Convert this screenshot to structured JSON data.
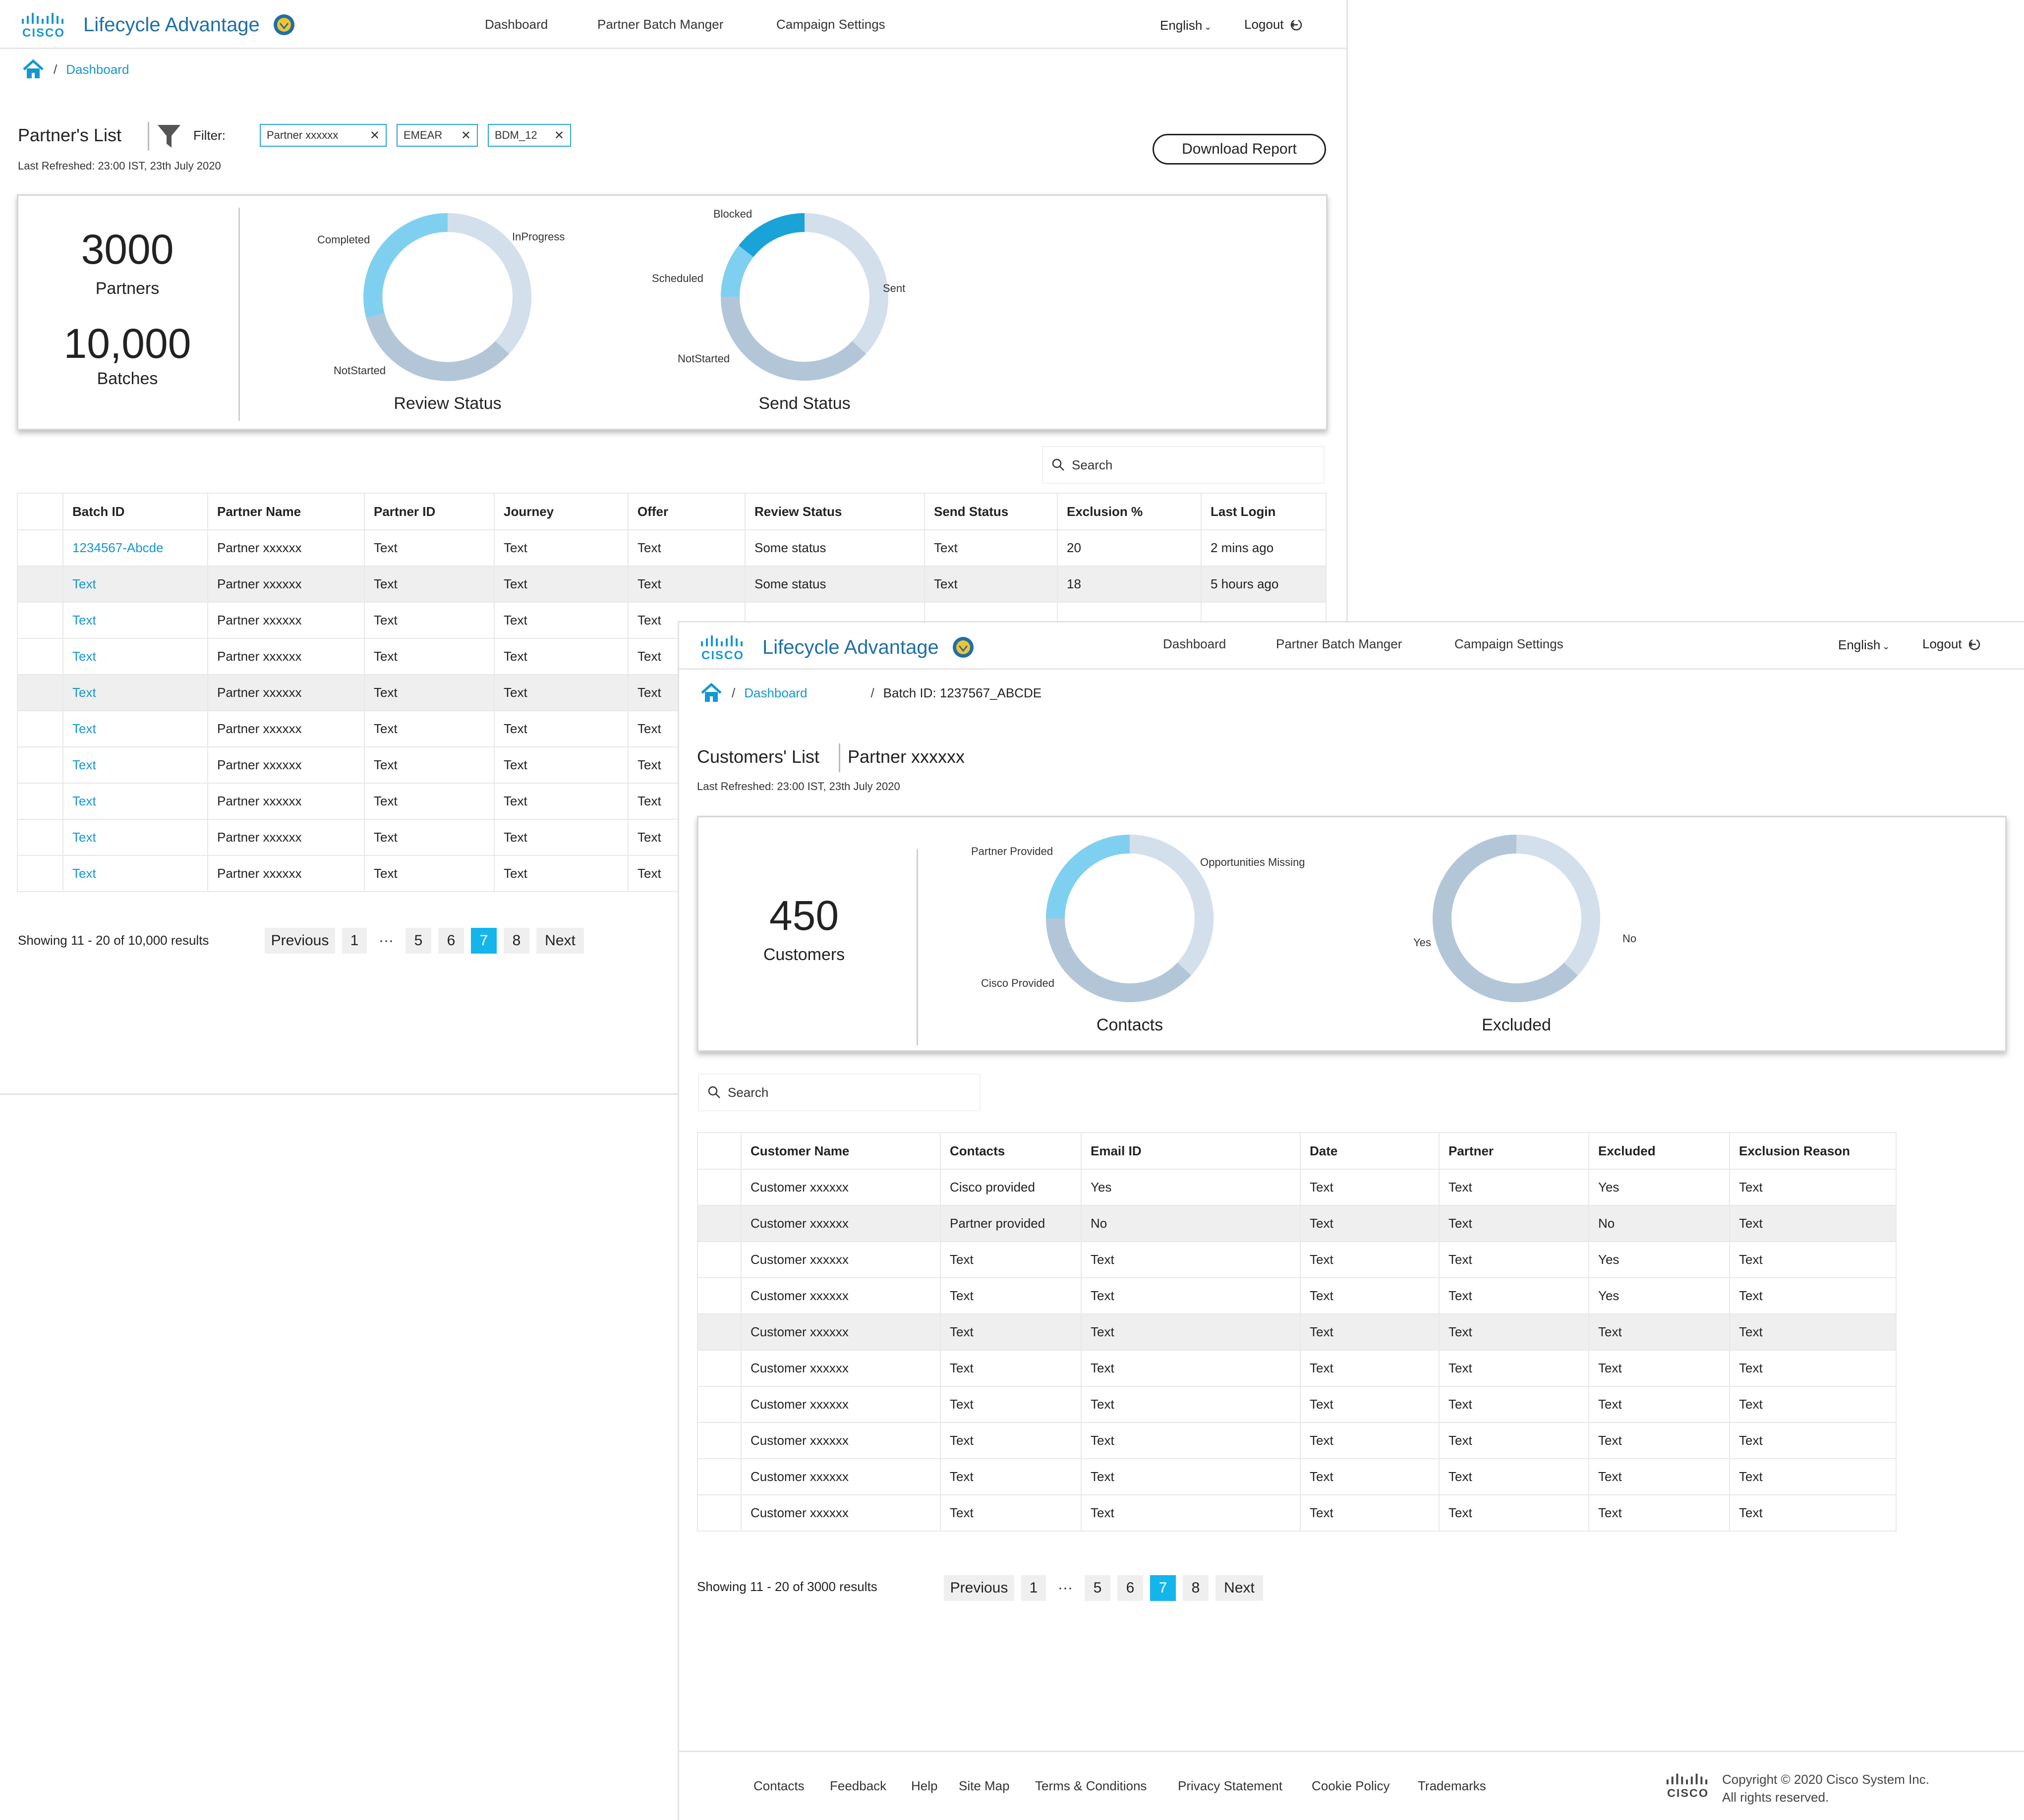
{
  "colors": {
    "accent": "#1597d2",
    "active_page": "#13b5ea",
    "donut_dark": "#1aa3d6",
    "donut_light": "#7fd0f0",
    "donut_pale": "#d3dfeb",
    "donut_mid": "#b2c6d8"
  },
  "win1": {
    "brand": {
      "logo_icon": "cisco-logo-icon",
      "title": "Lifecycle Advantage"
    },
    "nav": {
      "dashboard": "Dashboard",
      "batch": "Partner Batch Manger",
      "campaign": "Campaign Settings"
    },
    "lang": "English",
    "logout": "Logout",
    "crumb": {
      "sep": "/",
      "dashboard": "Dashboard"
    },
    "title": "Partner's List",
    "filter_label": "Filter:",
    "chips": [
      "Partner xxxxxx",
      "EMEAR",
      "BDM_12"
    ],
    "chip_close": "✕",
    "refreshed": "Last Refreshed: 23:00 IST, 23th July 2020",
    "download": "Download Report",
    "stats": {
      "partners_value": "3000",
      "partners_label": "Partners",
      "batches_value": "10,000",
      "batches_label": "Batches"
    },
    "review_labels": {
      "completed": "Completed",
      "inprogress": "InProgress",
      "notstarted": "NotStarted",
      "title": "Review Status"
    },
    "send_labels": {
      "blocked": "Blocked",
      "scheduled": "Scheduled",
      "sent": "Sent",
      "notstarted": "NotStarted",
      "title": "Send Status"
    },
    "search_placeholder": "Search",
    "table": {
      "headers": [
        "Batch ID",
        "Partner Name",
        "Partner ID",
        "Journey",
        "Offer",
        "Review Status",
        "Send Status",
        "Exclusion %",
        "Last Login"
      ],
      "rows": [
        [
          "1234567-Abcde",
          "Partner xxxxxx",
          "Text",
          "Text",
          "Text",
          "Some status",
          "Text",
          "20",
          "2 mins ago"
        ],
        [
          "Text",
          "Partner xxxxxx",
          "Text",
          "Text",
          "Text",
          "Some status",
          "Text",
          "18",
          "5 hours ago"
        ],
        [
          "Text",
          "Partner xxxxxx",
          "Text",
          "Text",
          "Text",
          "",
          "",
          "",
          ""
        ],
        [
          "Text",
          "Partner xxxxxx",
          "Text",
          "Text",
          "Text",
          "",
          "",
          "",
          ""
        ],
        [
          "Text",
          "Partner xxxxxx",
          "Text",
          "Text",
          "Text",
          "",
          "",
          "",
          ""
        ],
        [
          "Text",
          "Partner xxxxxx",
          "Text",
          "Text",
          "Text",
          "",
          "",
          "",
          ""
        ],
        [
          "Text",
          "Partner xxxxxx",
          "Text",
          "Text",
          "Text",
          "",
          "",
          "",
          ""
        ],
        [
          "Text",
          "Partner xxxxxx",
          "Text",
          "Text",
          "Text",
          "",
          "",
          "",
          ""
        ],
        [
          "Text",
          "Partner xxxxxx",
          "Text",
          "Text",
          "Text",
          "",
          "",
          "",
          ""
        ],
        [
          "Text",
          "Partner xxxxxx",
          "Text",
          "Text",
          "Text",
          "",
          "",
          "",
          ""
        ]
      ]
    },
    "pager": {
      "info": "Showing 11 - 20 of 10,000 results",
      "prev": "Previous",
      "p1": "1",
      "dots": "···",
      "p5": "5",
      "p6": "6",
      "p7": "7",
      "p8": "8",
      "next": "Next"
    }
  },
  "win2": {
    "brand": {
      "logo_icon": "cisco-logo-icon",
      "title": "Lifecycle Advantage"
    },
    "nav": {
      "dashboard": "Dashboard",
      "batch": "Partner Batch Manger",
      "campaign": "Campaign Settings"
    },
    "lang": "English",
    "logout": "Logout",
    "crumb": {
      "sep": "/",
      "dashboard": "Dashboard",
      "batch": "Batch ID: 1237567_ABCDE"
    },
    "title": "Customers' List",
    "partner": "Partner xxxxxx",
    "refreshed": "Last Refreshed: 23:00 IST, 23th July 2020",
    "stats": {
      "customers_value": "450",
      "customers_label": "Customers"
    },
    "contacts_labels": {
      "partner": "Partner Provided",
      "opps": "Opportunities Missing",
      "cisco": "Cisco Provided",
      "title": "Contacts"
    },
    "excluded_labels": {
      "yes": "Yes",
      "no": "No",
      "title": "Excluded"
    },
    "search_placeholder": "Search",
    "table": {
      "headers": [
        "Customer Name",
        "Contacts",
        "Email ID",
        "Date",
        "Partner",
        "Excluded",
        "Exclusion Reason"
      ],
      "rows": [
        [
          "Customer xxxxxx",
          "Cisco provided",
          "Yes",
          "Text",
          "Text",
          "Yes",
          "Text"
        ],
        [
          "Customer xxxxxx",
          "Partner provided",
          "No",
          "Text",
          "Text",
          "No",
          "Text"
        ],
        [
          "Customer xxxxxx",
          "Text",
          "Text",
          "Text",
          "Text",
          "Yes",
          "Text"
        ],
        [
          "Customer xxxxxx",
          "Text",
          "Text",
          "Text",
          "Text",
          "Yes",
          "Text"
        ],
        [
          "Customer xxxxxx",
          "Text",
          "Text",
          "Text",
          "Text",
          "Text",
          "Text"
        ],
        [
          "Customer xxxxxx",
          "Text",
          "Text",
          "Text",
          "Text",
          "Text",
          "Text"
        ],
        [
          "Customer xxxxxx",
          "Text",
          "Text",
          "Text",
          "Text",
          "Text",
          "Text"
        ],
        [
          "Customer xxxxxx",
          "Text",
          "Text",
          "Text",
          "Text",
          "Text",
          "Text"
        ],
        [
          "Customer xxxxxx",
          "Text",
          "Text",
          "Text",
          "Text",
          "Text",
          "Text"
        ],
        [
          "Customer xxxxxx",
          "Text",
          "Text",
          "Text",
          "Text",
          "Text",
          "Text"
        ]
      ]
    },
    "pager": {
      "info": "Showing 11 - 20 of 3000 results",
      "prev": "Previous",
      "p1": "1",
      "dots": "···",
      "p5": "5",
      "p6": "6",
      "p7": "7",
      "p8": "8",
      "next": "Next"
    },
    "footer": {
      "links": [
        "Contacts",
        "Feedback",
        "Help",
        "Site Map",
        "Terms & Conditions",
        "Privacy Statement",
        "Cookie Policy",
        "Trademarks"
      ],
      "copyright": "Copyright © 2020 Cisco System Inc.",
      "rights": "All rights reserved."
    }
  }
}
